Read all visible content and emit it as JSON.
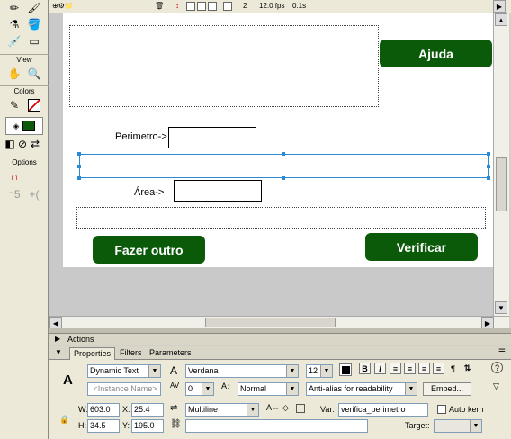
{
  "tools": {
    "view_label": "View",
    "colors_label": "Colors",
    "options_label": "Options"
  },
  "timeline": {
    "frame": "2",
    "fps": "12.0 fps",
    "time": "0.1s"
  },
  "stage": {
    "help_button": "Ajuda",
    "perimeter_label": "Perimetro->",
    "area_label": "Área->",
    "new_button": "Fazer outro",
    "check_button": "Verificar"
  },
  "panels": {
    "actions": "Actions",
    "tabs": [
      "Properties",
      "Filters",
      "Parameters"
    ]
  },
  "properties": {
    "text_type": "Dynamic Text",
    "instance_placeholder": "<Instance Name>",
    "font": "Verdana",
    "size": "12",
    "letter_spacing": "0",
    "position": "Normal",
    "antialias": "Anti-alias for readability",
    "embed_button": "Embed...",
    "w_label": "W:",
    "w_value": "603.0",
    "x_label": "X:",
    "x_value": "25.4",
    "h_label": "H:",
    "h_value": "34.5",
    "y_label": "Y:",
    "y_value": "195.0",
    "line_type": "Multiline",
    "var_label": "Var:",
    "var_value": "verifica_perimetro",
    "auto_kern": "Auto kern",
    "target_label": "Target:"
  },
  "colors": {
    "button_green": "#0a5a0a",
    "selection_blue": "#2a8ad4"
  }
}
